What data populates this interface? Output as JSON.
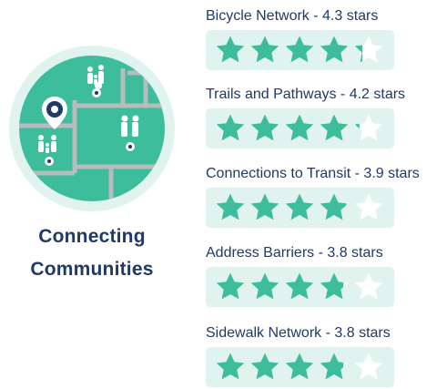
{
  "accent_color": "#3dbd9b",
  "star_empty_color": "#ffffff",
  "star_bg_color": "#e1f3ee",
  "text_color": "#1f3a66",
  "badge": {
    "title_line1": "Connecting",
    "title_line2": "Communities",
    "icons": [
      "map-pin-icon",
      "family-icon",
      "elderly-couple-icon"
    ]
  },
  "ratings": [
    {
      "label": "Bicycle Network - 4.3 stars",
      "stars": 4.3,
      "max": 5
    },
    {
      "label": "Trails and Pathways - 4.2 stars",
      "stars": 4.2,
      "max": 5
    },
    {
      "label": "Connections to Transit - 3.9 stars",
      "stars": 3.9,
      "max": 5
    },
    {
      "label": "Address Barriers - 3.8 stars",
      "stars": 3.8,
      "max": 5
    },
    {
      "label": "Sidewalk Network - 3.8 stars",
      "stars": 3.8,
      "max": 5
    }
  ]
}
